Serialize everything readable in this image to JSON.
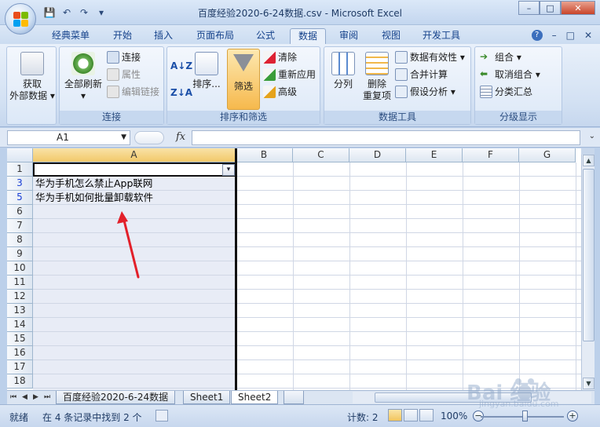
{
  "window": {
    "title": "百度经验2020-6-24数据.csv - Microsoft Excel",
    "controls": {
      "minimize": "–",
      "maximize": "□",
      "close": "✕"
    }
  },
  "qat": {
    "save": "💾",
    "undo": "↶",
    "redo": "↷",
    "customize": "▾"
  },
  "ribbon_tabs": [
    "经典菜单",
    "开始",
    "插入",
    "页面布局",
    "公式",
    "数据",
    "审阅",
    "视图",
    "开发工具"
  ],
  "active_tab": "数据",
  "tab_right": {
    "help": "?",
    "minimize": "–",
    "restore": "□",
    "close": "✕"
  },
  "groups": {
    "external": {
      "button": "获取\n外部数据",
      "line1": "获取",
      "line2": "外部数据 ▾"
    },
    "connections": {
      "label": "连接",
      "refresh_line1": "全部刷新",
      "refresh_line2": "▾",
      "connect": "连接",
      "properties": "属性",
      "edit_links": "编辑链接"
    },
    "sort_filter": {
      "label": "排序和筛选",
      "sort": "排序...",
      "filter": "筛选",
      "clear": "清除",
      "reapply": "重新应用",
      "advanced": "高级"
    },
    "data_tools": {
      "label": "数据工具",
      "text_to_columns": "分列",
      "remove_dup_line1": "删除",
      "remove_dup_line2": "重复项",
      "validation": "数据有效性 ▾",
      "consolidate": "合并计算",
      "whatif": "假设分析 ▾"
    },
    "outline": {
      "label": "分级显示",
      "group": "组合 ▾",
      "ungroup": "取消组合 ▾",
      "subtotal": "分类汇总"
    }
  },
  "formula_bar": {
    "name_box": "A1",
    "fx": "fx",
    "value": ""
  },
  "grid": {
    "columns": [
      "A",
      "B",
      "C",
      "D",
      "E",
      "F",
      "G"
    ],
    "rows": [
      "1",
      "3",
      "5",
      "6",
      "7",
      "8",
      "9",
      "10",
      "11",
      "12",
      "13",
      "14",
      "15",
      "16",
      "17",
      "18"
    ],
    "cells": {
      "A3": "华为手机怎么禁止App联网",
      "A5": "华为手机如何批量卸载软件"
    }
  },
  "sheets": [
    "百度经验2020-6-24数据",
    "Sheet1",
    "Sheet2"
  ],
  "active_sheet": "Sheet2",
  "status": {
    "ready": "就绪",
    "filter_msg": "在 4 条记录中找到 2 个",
    "count": "计数: 2",
    "zoom": "100%",
    "zoom_out": "−",
    "zoom_in": "+"
  },
  "watermark": {
    "text": "Bai 经验",
    "url": "jingyan.baidu.com"
  },
  "colors": {
    "annotation_arrow": "#e2202a",
    "accent": "#15428b",
    "selected_header": "#f2c96a"
  }
}
